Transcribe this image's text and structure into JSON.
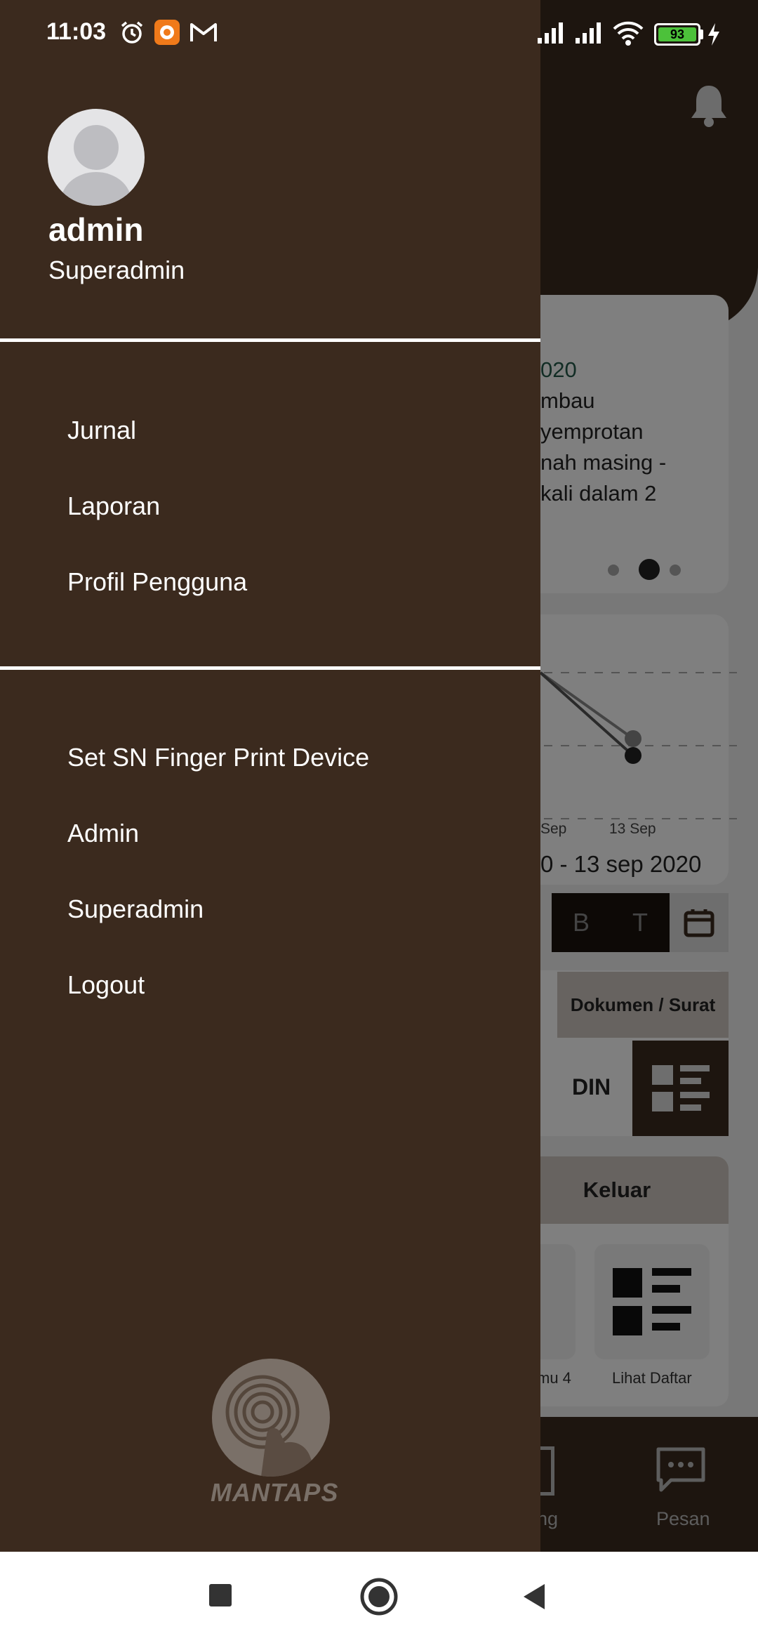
{
  "status_bar": {
    "time": "11:03",
    "battery_level": "93",
    "icons": [
      "alarm-icon",
      "app-notification-icon",
      "gmail-icon",
      "signal-icon",
      "signal-icon",
      "wifi-icon",
      "battery-icon",
      "charging-icon"
    ]
  },
  "drawer": {
    "user_name": "admin",
    "user_role": "Superadmin",
    "menu_group_1": [
      {
        "label": "Jurnal"
      },
      {
        "label": "Laporan"
      },
      {
        "label": "Profil Pengguna"
      }
    ],
    "menu_group_2": [
      {
        "label": "Set SN Finger Print Device"
      },
      {
        "label": "Admin"
      },
      {
        "label": "Superadmin"
      },
      {
        "label": "Logout"
      }
    ],
    "brand": "MANTAPS"
  },
  "background": {
    "announcement": {
      "date_fragment": "020",
      "lines": [
        "mbau",
        "yemprotan",
        "nah masing -",
        "kali dalam 2"
      ],
      "carousel_active_index": 1,
      "carousel_count": 3
    },
    "chart": {
      "x_tick_partial": "Sep",
      "x_tick": "13 Sep",
      "range_label": "0 - 13 sep 2020",
      "segments": [
        "B",
        "T"
      ]
    },
    "tabs": {
      "documents": "Dokumen / Surat",
      "din_fragment": "DIN"
    },
    "keluar_label": "Keluar",
    "tiles": [
      {
        "label": "mu 4"
      },
      {
        "label": "Lihat Daftar"
      }
    ],
    "bottom_nav": {
      "partial_label": "ng",
      "pesan_label": "Pesan"
    }
  },
  "colors": {
    "drawer_bg": "#3b2a1e",
    "divider": "#ffffff",
    "battery_fill": "#4cc13a"
  }
}
